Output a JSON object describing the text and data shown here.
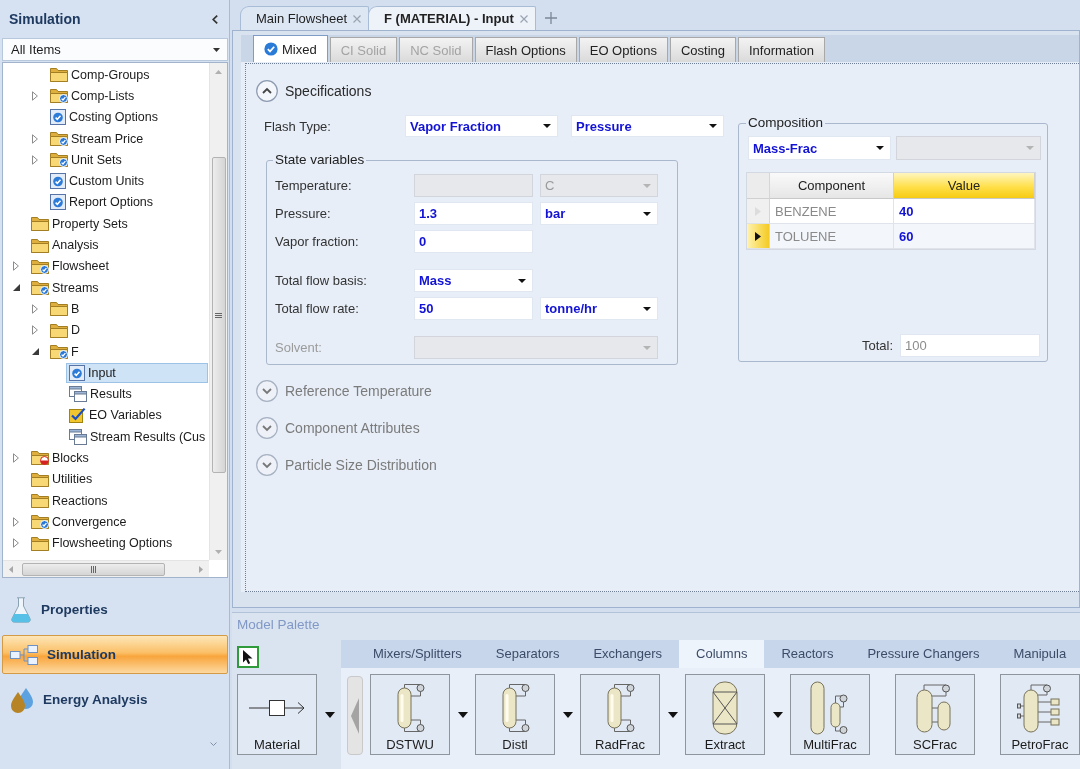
{
  "sidebar": {
    "title": "Simulation",
    "filter": "All Items",
    "tree": [
      {
        "children": [
          {
            "label": "Comp-Groups",
            "kind": "folder",
            "complete": false,
            "error": false,
            "selected": false
          },
          {
            "label": "Comp-Lists",
            "kind": "folder",
            "complete": true,
            "error": false,
            "expanded": false,
            "selected": false
          },
          {
            "label": "Costing Options",
            "kind": "form",
            "complete": true,
            "selected": false
          },
          {
            "label": "Stream Price",
            "kind": "folder",
            "complete": true,
            "error": false,
            "expanded": false,
            "selected": false
          },
          {
            "label": "Unit Sets",
            "kind": "folder",
            "complete": true,
            "error": false,
            "expanded": false,
            "selected": false
          },
          {
            "label": "Custom Units",
            "kind": "form",
            "complete": true,
            "selected": false
          },
          {
            "label": "Report Options",
            "kind": "form",
            "complete": true,
            "selected": false
          }
        ]
      },
      {
        "label": "Property Sets",
        "kind": "folder",
        "complete": false,
        "error": false,
        "selected": false
      },
      {
        "label": "Analysis",
        "kind": "folder",
        "complete": false,
        "error": false,
        "selected": false
      },
      {
        "label": "Flowsheet",
        "kind": "folder",
        "complete": true,
        "error": false,
        "expanded": false,
        "selected": false
      },
      {
        "label": "Streams",
        "kind": "folder",
        "complete": true,
        "error": false,
        "expanded": true,
        "selected": false,
        "children": [
          {
            "label": "B",
            "kind": "folder",
            "complete": false,
            "error": false,
            "expanded": false,
            "selected": false
          },
          {
            "label": "D",
            "kind": "folder",
            "complete": false,
            "error": false,
            "expanded": false,
            "selected": false
          },
          {
            "label": "F",
            "kind": "folder",
            "complete": true,
            "error": false,
            "expanded": true,
            "selected": false,
            "children": [
              {
                "label": "Input",
                "kind": "form",
                "complete": true,
                "selected": true
              },
              {
                "label": "Results",
                "kind": "results",
                "selected": false
              },
              {
                "label": "EO Variables",
                "kind": "variables",
                "selected": false
              },
              {
                "label": "Stream Results (Cus",
                "kind": "results",
                "selected": false
              }
            ]
          }
        ]
      },
      {
        "label": "Blocks",
        "kind": "folder",
        "error": true,
        "expanded": false,
        "selected": false
      },
      {
        "label": "Utilities",
        "kind": "folder",
        "complete": false,
        "error": false,
        "selected": false
      },
      {
        "label": "Reactions",
        "kind": "folder",
        "complete": false,
        "error": false,
        "selected": false
      },
      {
        "label": "Convergence",
        "kind": "folder",
        "complete": true,
        "error": false,
        "expanded": false,
        "selected": false
      },
      {
        "label": "Flowsheeting Options",
        "kind": "folder",
        "complete": false,
        "error": false,
        "expanded": false,
        "selected": false
      }
    ]
  },
  "nav": [
    {
      "label": "Properties",
      "selected": false
    },
    {
      "label": "Simulation",
      "selected": true
    },
    {
      "label": "Energy Analysis",
      "selected": false
    }
  ],
  "document_tabs": [
    {
      "label": "Main Flowsheet",
      "selected": false
    },
    {
      "label": "F (MATERIAL) - Input",
      "selected": true
    }
  ],
  "form_tabs": [
    {
      "label": "Mixed",
      "selected": true,
      "disabled": false,
      "complete": true
    },
    {
      "label": "CI Solid",
      "selected": false,
      "disabled": true,
      "complete": false
    },
    {
      "label": "NC Solid",
      "selected": false,
      "disabled": true,
      "complete": false
    },
    {
      "label": "Flash Options",
      "selected": false,
      "disabled": false,
      "complete": false
    },
    {
      "label": "EO Options",
      "selected": false,
      "disabled": false,
      "complete": false
    },
    {
      "label": "Costing",
      "selected": false,
      "disabled": false,
      "complete": false
    },
    {
      "label": "Information",
      "selected": false,
      "disabled": false,
      "complete": false
    }
  ],
  "specifications": {
    "title": "Specifications",
    "expanded": true,
    "flash_type": {
      "label": "Flash Type:",
      "values": [
        "Vapor Fraction",
        "Pressure"
      ]
    },
    "state_variables": {
      "title": "State variables",
      "groups": [
        [
          {
            "kind": "input",
            "label": "Temperature:",
            "disabled": false,
            "field": {
              "disabled": true
            },
            "unit": {
              "value": "C",
              "disabled": true
            }
          },
          {
            "kind": "input",
            "label": "Pressure:",
            "disabled": false,
            "field": {
              "value": "1.3",
              "disabled": false
            },
            "unit": {
              "value": "bar",
              "disabled": false
            }
          },
          {
            "kind": "input",
            "label": "Vapor fraction:",
            "disabled": false,
            "field": {
              "value": "0",
              "disabled": false
            }
          }
        ],
        [
          {
            "kind": "select",
            "label": "Total flow basis:",
            "disabled": false,
            "field": {
              "value": "Mass",
              "disabled": false
            }
          },
          {
            "kind": "input",
            "label": "Total flow rate:",
            "disabled": false,
            "field": {
              "value": "50",
              "disabled": false
            },
            "unit": {
              "value": "tonne/hr",
              "disabled": false
            }
          }
        ],
        [
          {
            "kind": "wide",
            "label": "Solvent:",
            "disabled": true,
            "field": {
              "disabled": true
            }
          }
        ]
      ]
    },
    "composition": {
      "title": "Composition",
      "basis": {
        "value": "Mass-Frac",
        "disabled": false
      },
      "select_2": {
        "disabled": true
      },
      "columns": [
        {
          "label": "Component",
          "selected": false
        },
        {
          "label": "Value",
          "selected": true
        }
      ],
      "rows": [
        {
          "component": "BENZENE",
          "value": "40",
          "selected": false
        },
        {
          "component": "TOLUENE",
          "value": "60",
          "selected": true
        }
      ],
      "total": {
        "label": "Total:",
        "value": "100"
      }
    }
  },
  "other_sections": [
    {
      "title": "Reference Temperature",
      "expanded": false
    },
    {
      "title": "Component Attributes",
      "expanded": false
    },
    {
      "title": "Particle Size Distribution",
      "expanded": false
    }
  ],
  "model_palette": {
    "title": "Model Palette",
    "pointer_tool": {
      "selected": true
    },
    "categories": [
      {
        "label": "Mixers/Splitters",
        "selected": false
      },
      {
        "label": "Separators",
        "selected": false
      },
      {
        "label": "Exchangers",
        "selected": false
      },
      {
        "label": "Columns",
        "selected": true
      },
      {
        "label": "Reactors",
        "selected": false
      },
      {
        "label": "Pressure Changers",
        "selected": false
      },
      {
        "label": "Manipula",
        "selected": false
      }
    ],
    "stream_item": {
      "label": "Material",
      "kind": "stream",
      "menu": true
    },
    "items": [
      {
        "label": "DSTWU",
        "kind": "column",
        "menu": true
      },
      {
        "label": "Distl",
        "kind": "column",
        "menu": true
      },
      {
        "label": "RadFrac",
        "kind": "column",
        "menu": true
      },
      {
        "label": "Extract",
        "kind": "extractor",
        "menu": true
      },
      {
        "label": "MultiFrac",
        "kind": "multicolumn",
        "menu": false
      },
      {
        "label": "SCFrac",
        "kind": "sidecolumn",
        "menu": false
      },
      {
        "label": "PetroFrac",
        "kind": "petrocolumn",
        "menu": false
      }
    ]
  }
}
